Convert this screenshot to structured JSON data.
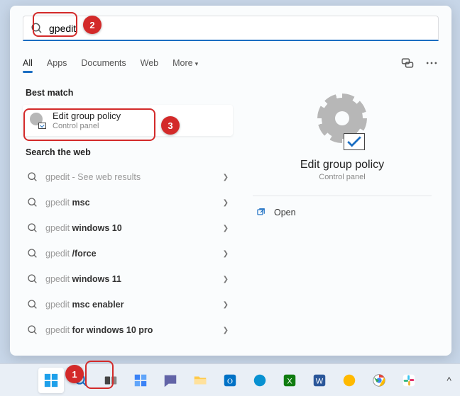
{
  "search": {
    "query": "gpedit"
  },
  "tabs": [
    "All",
    "Apps",
    "Documents",
    "Web",
    "More"
  ],
  "best_match": {
    "heading": "Best match",
    "title": "Edit group policy",
    "subtitle": "Control panel"
  },
  "web": {
    "heading": "Search the web",
    "items": [
      {
        "prefix": "gpedit",
        "suffix": "",
        "hint": " - See web results"
      },
      {
        "prefix": "gpedit ",
        "suffix": "msc",
        "hint": ""
      },
      {
        "prefix": "gpedit ",
        "suffix": "windows 10",
        "hint": ""
      },
      {
        "prefix": "gpedit ",
        "suffix": "/force",
        "hint": ""
      },
      {
        "prefix": "gpedit ",
        "suffix": "windows 11",
        "hint": ""
      },
      {
        "prefix": "gpedit ",
        "suffix": "msc enabler",
        "hint": ""
      },
      {
        "prefix": "gpedit ",
        "suffix": "for windows 10 pro",
        "hint": ""
      }
    ]
  },
  "preview": {
    "title": "Edit group policy",
    "subtitle": "Control panel",
    "action": "Open"
  },
  "annotations": [
    "1",
    "2",
    "3"
  ]
}
